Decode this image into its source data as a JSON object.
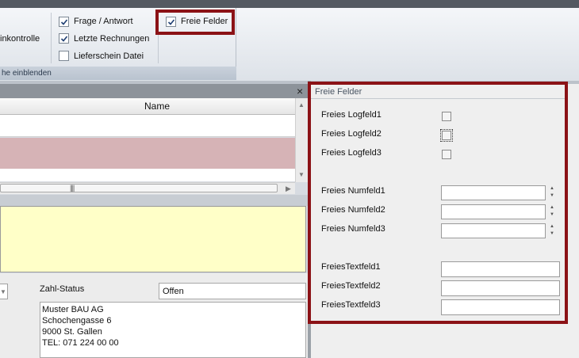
{
  "ribbon": {
    "left_partial_label": "inkontrolle",
    "group_footer": "he einblenden",
    "items": [
      {
        "label": "Frage / Antwort",
        "checked": true
      },
      {
        "label": "Letzte Rechnungen",
        "checked": true
      },
      {
        "label": "Lieferschein Datei",
        "checked": false
      }
    ],
    "freie_felder": {
      "label": "Freie Felder",
      "checked": true
    }
  },
  "left_grid": {
    "close_glyph": "×",
    "column_header": "Name"
  },
  "details": {
    "zahl_status_label": "Zahl-Status",
    "zahl_status_value": "Offen",
    "address": [
      "Muster BAU AG",
      "Schochengasse 6",
      "9000 St. Gallen",
      "TEL: 071 224 00 00"
    ]
  },
  "freie_felder_panel": {
    "title": "Freie Felder",
    "logfelder": [
      {
        "label": "Freies Logfeld1",
        "checked": false
      },
      {
        "label": "Freies Logfeld2",
        "checked": false
      },
      {
        "label": "Freies Logfeld3",
        "checked": false
      }
    ],
    "numfelder": [
      {
        "label": "Freies Numfeld1",
        "value": ""
      },
      {
        "label": "Freies Numfeld2",
        "value": ""
      },
      {
        "label": "Freies Numfeld3",
        "value": ""
      }
    ],
    "textfelder": [
      {
        "label": "FreiesTextfeld1",
        "value": ""
      },
      {
        "label": "FreiesTextfeld2",
        "value": ""
      },
      {
        "label": "FreiesTextfeld3",
        "value": ""
      }
    ]
  },
  "colors": {
    "highlight": "#8b1216",
    "selected_row": "#d6b3b6",
    "memo_background": "#ffffc8"
  }
}
